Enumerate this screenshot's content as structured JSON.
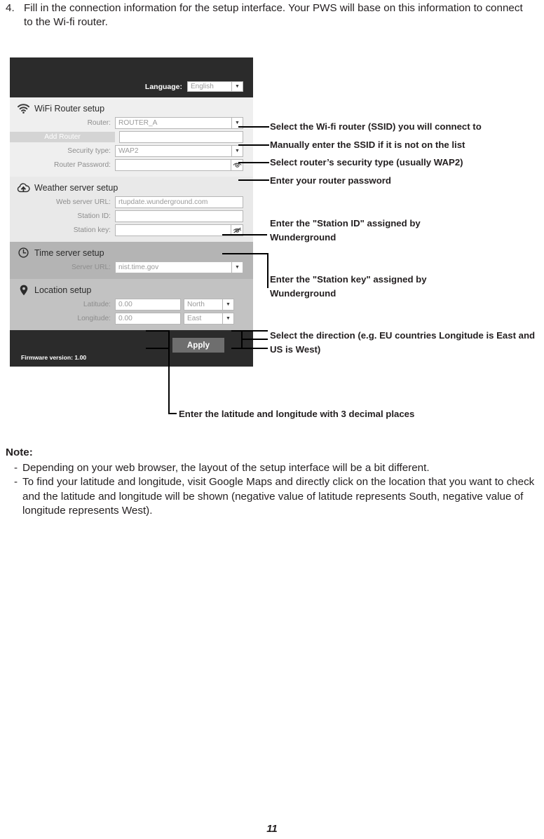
{
  "step": {
    "number": "4.",
    "text": "Fill in the connection information for the setup interface. Your PWS will base on this information to connect to the Wi-fi router."
  },
  "setup_panel": {
    "header": {
      "language_label": "Language:",
      "language_value": "English"
    },
    "wifi_section": {
      "title": "WiFi Router setup",
      "icon": "wifi-icon",
      "router_label": "Router:",
      "router_value": "ROUTER_A",
      "add_router_label": "Add Router",
      "add_router_value": "",
      "security_label": "Security type:",
      "security_value": "WAP2",
      "password_label": "Router Password:",
      "password_value": "",
      "password_toggle_icon": "eye-icon"
    },
    "weather_section": {
      "title": "Weather server setup",
      "icon": "cloud-upload-icon",
      "web_url_label": "Web server URL:",
      "web_url_value": "rtupdate.wunderground.com",
      "station_id_label": "Station ID:",
      "station_id_value": "",
      "station_key_label": "Station key:",
      "station_key_value": "",
      "station_key_toggle_icon": "eye-slash-icon"
    },
    "time_section": {
      "title": "Time server setup",
      "icon": "clock-icon",
      "server_url_label": "Server URL:",
      "server_url_value": "nist.time.gov"
    },
    "location_section": {
      "title": "Location setup",
      "icon": "map-pin-icon",
      "latitude_label": "Latitude:",
      "latitude_value": "0.00",
      "latitude_direction": "North",
      "longitude_label": "Longitude:",
      "longitude_value": "0.00",
      "longitude_direction": "East"
    },
    "footer": {
      "firmware_text": "Firmware version: 1.00",
      "apply_label": "Apply"
    }
  },
  "callouts": {
    "router_select": "Select the Wi-fi router (SSID) you will connect to",
    "manual_ssid": "Manually enter the SSID if it is not on the list",
    "security_type": "Select router’s security type (usually WAP2)",
    "router_password": "Enter your router password",
    "station_id": "Enter the \"Station ID\" assigned by Wunderground",
    "station_key": "Enter the \"Station key\" assigned by Wunderground",
    "direction": "Select the direction (e.g. EU countries Longitude is East and US is West)",
    "lat_long": "Enter the latitude and longitude with 3 decimal places"
  },
  "note": {
    "title": "Note:",
    "dash": "-",
    "items": [
      "Depending on your web browser, the layout of the setup interface will be a bit different.",
      "To find your latitude and longitude, visit Google Maps and directly click on the location that you want to check and the latitude and longitude will be shown (negative value of latitude represents South, negative value of longitude represents West)."
    ]
  },
  "page_number": "11"
}
